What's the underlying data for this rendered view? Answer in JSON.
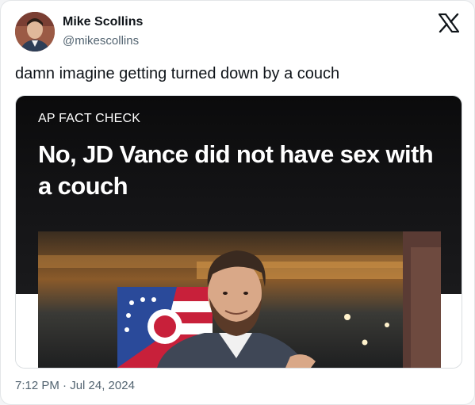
{
  "author": {
    "name": "Mike Scollins",
    "handle": "@mikescollins"
  },
  "tweet": {
    "text": "damn imagine getting turned down by a couch",
    "timestamp": "7:12 PM · Jul 24, 2024"
  },
  "media": {
    "kicker": "AP FACT CHECK",
    "headline": "No, JD Vance did not have sex with a couch"
  },
  "icons": {
    "platform_logo": "x-logo-icon",
    "avatar": "avatar-photo"
  },
  "colors": {
    "text_primary": "#0f1419",
    "text_secondary": "#536471",
    "media_dark": "#0b0b0c"
  }
}
